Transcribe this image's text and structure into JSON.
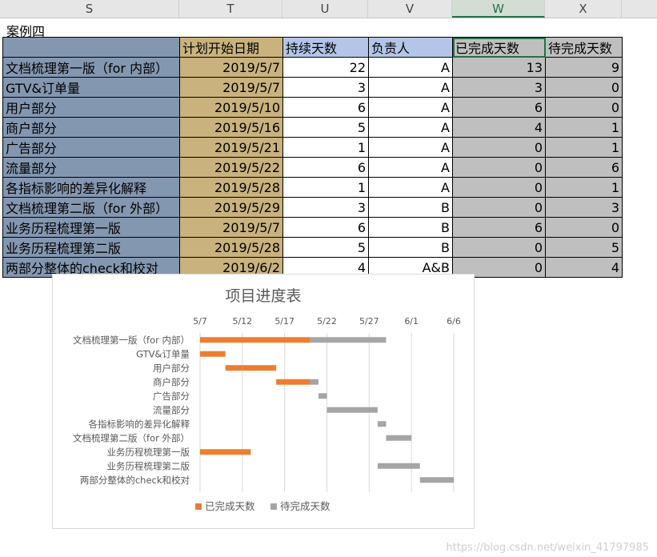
{
  "columns": [
    "S",
    "T",
    "U",
    "V",
    "W",
    "X"
  ],
  "caption": "案例四",
  "table": {
    "headers": [
      "",
      "计划开始日期",
      "持续天数",
      "负责人",
      "已完成天数",
      "待完成天数"
    ],
    "rows": [
      {
        "task": "文档梳理第一版（for 内部）",
        "start": "2019/5/7",
        "duration": "22",
        "owner": "A",
        "done": "13",
        "todo": "9"
      },
      {
        "task": "GTV&订单量",
        "start": "2019/5/7",
        "duration": "3",
        "owner": "A",
        "done": "3",
        "todo": "0"
      },
      {
        "task": "用户部分",
        "start": "2019/5/10",
        "duration": "6",
        "owner": "A",
        "done": "6",
        "todo": "0"
      },
      {
        "task": "商户部分",
        "start": "2019/5/16",
        "duration": "5",
        "owner": "A",
        "done": "4",
        "todo": "1"
      },
      {
        "task": "广告部分",
        "start": "2019/5/21",
        "duration": "1",
        "owner": "A",
        "done": "0",
        "todo": "1"
      },
      {
        "task": "流量部分",
        "start": "2019/5/22",
        "duration": "6",
        "owner": "A",
        "done": "0",
        "todo": "6"
      },
      {
        "task": "各指标影响的差异化解释",
        "start": "2019/5/28",
        "duration": "1",
        "owner": "A",
        "done": "0",
        "todo": "1"
      },
      {
        "task": "文档梳理第二版（for 外部）",
        "start": "2019/5/29",
        "duration": "3",
        "owner": "B",
        "done": "0",
        "todo": "3"
      },
      {
        "task": "业务历程梳理第一版",
        "start": "2019/5/7",
        "duration": "6",
        "owner": "B",
        "done": "6",
        "todo": "0"
      },
      {
        "task": "业务历程梳理第二版",
        "start": "2019/5/28",
        "duration": "5",
        "owner": "B",
        "done": "0",
        "todo": "5"
      },
      {
        "task": "两部分整体的check和校对",
        "start": "2019/6/2",
        "duration": "4",
        "owner": "A&B",
        "done": "0",
        "todo": "4"
      }
    ]
  },
  "chart_data": {
    "type": "bar",
    "title": "项目进度表",
    "orientation": "horizontal-stacked",
    "categories": [
      "文档梳理第一版（for 内部）",
      "GTV&订单量",
      "用户部分",
      "商户部分",
      "广告部分",
      "流量部分",
      "各指标影响的差异化解释",
      "文档梳理第二版（for 外部）",
      "业务历程梳理第一版",
      "业务历程梳理第二版",
      "两部分整体的check和校对"
    ],
    "start": [
      "2019-05-07",
      "2019-05-07",
      "2019-05-10",
      "2019-05-16",
      "2019-05-21",
      "2019-05-22",
      "2019-05-28",
      "2019-05-29",
      "2019-05-07",
      "2019-05-28",
      "2019-06-02"
    ],
    "series": [
      {
        "name": "已完成天数",
        "color": "#ed7d31",
        "values": [
          13,
          3,
          6,
          4,
          0,
          0,
          0,
          0,
          6,
          0,
          0
        ]
      },
      {
        "name": "待完成天数",
        "color": "#a5a5a5",
        "values": [
          9,
          0,
          0,
          1,
          1,
          6,
          1,
          3,
          0,
          5,
          4
        ]
      }
    ],
    "xrange": [
      "2019-05-07",
      "2019-06-06"
    ],
    "xticks": [
      "2019-05-07",
      "2019-05-12",
      "2019-05-17",
      "2019-05-22",
      "2019-05-27",
      "2019-06-01",
      "2019-06-06"
    ],
    "xtick_labels": [
      "5/7",
      "5/12",
      "5/17",
      "5/22",
      "5/27",
      "6/1",
      "6/6"
    ],
    "legend": "bottom",
    "grid": true
  },
  "watermark": "https://blog.csdn.net/weixin_41797985"
}
